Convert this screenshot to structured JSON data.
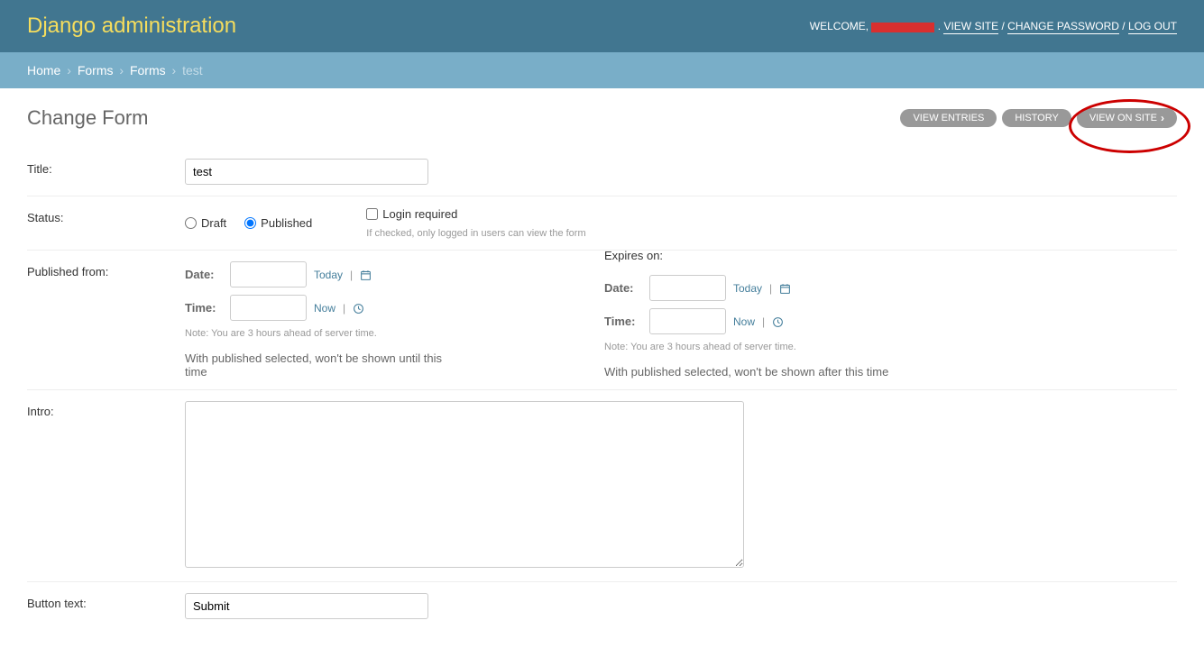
{
  "header": {
    "brand": "Django administration",
    "welcome": "WELCOME,",
    "links": {
      "view_site": "VIEW SITE",
      "change_password": "CHANGE PASSWORD",
      "log_out": "LOG OUT"
    }
  },
  "breadcrumbs": {
    "home": "Home",
    "app": "Forms",
    "model": "Forms",
    "current": "test"
  },
  "page": {
    "title": "Change Form",
    "tools": {
      "view_entries": "VIEW ENTRIES",
      "history": "HISTORY",
      "view_on_site": "VIEW ON SITE"
    }
  },
  "form": {
    "title": {
      "label": "Title:",
      "value": "test"
    },
    "status": {
      "label": "Status:",
      "options": {
        "draft": "Draft",
        "published": "Published",
        "selected": "published"
      },
      "login_required": {
        "label": "Login required",
        "checked": false,
        "help": "If checked, only logged in users can view the form"
      }
    },
    "published_from": {
      "label": "Published from:",
      "date_label": "Date:",
      "time_label": "Time:",
      "today": "Today",
      "now": "Now",
      "note": "Note: You are 3 hours ahead of server time.",
      "help": "With published selected, won't be shown until this time"
    },
    "expires_on": {
      "label": "Expires on:",
      "date_label": "Date:",
      "time_label": "Time:",
      "today": "Today",
      "now": "Now",
      "note": "Note: You are 3 hours ahead of server time.",
      "help": "With published selected, won't be shown after this time"
    },
    "intro": {
      "label": "Intro:",
      "value": ""
    },
    "button_text": {
      "label": "Button text:",
      "value": "Submit"
    }
  }
}
